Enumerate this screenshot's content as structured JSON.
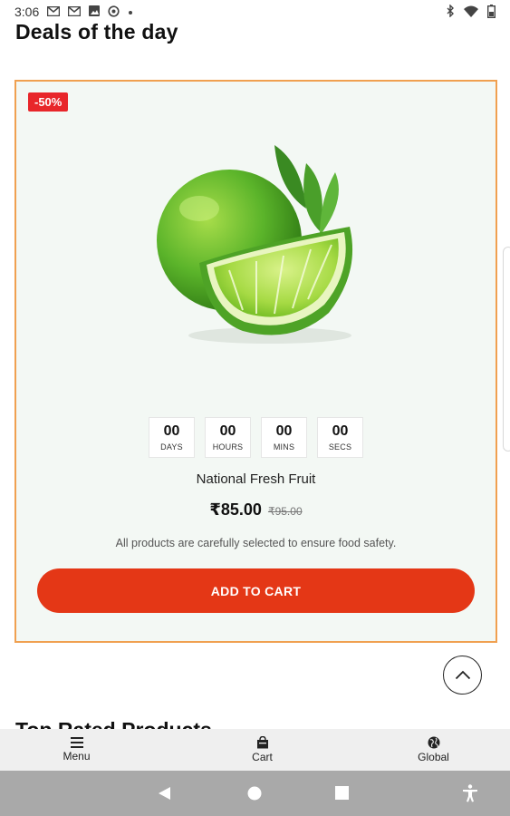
{
  "status_bar": {
    "time": "3:06",
    "left_icons": [
      "mail-icon",
      "mail-icon",
      "image-icon",
      "sync-icon",
      "dot-icon"
    ],
    "right_icons": [
      "bluetooth-icon",
      "wifi-icon",
      "battery-icon"
    ]
  },
  "section": {
    "title": "Deals of the day"
  },
  "deal": {
    "badge": "-50%",
    "image_icon": "lime-fruit-image",
    "countdown": [
      {
        "value": "00",
        "label": "DAYS"
      },
      {
        "value": "00",
        "label": "HOURS"
      },
      {
        "value": "00",
        "label": "MINS"
      },
      {
        "value": "00",
        "label": "SECS"
      }
    ],
    "product_name": "National Fresh Fruit",
    "price": "₹85.00",
    "old_price": "₹95.00",
    "description": "All products are carefully selected to ensure food safety.",
    "cta": "ADD TO CART"
  },
  "next_section": {
    "title": "Top Rated Products"
  },
  "bottom_nav": [
    {
      "label": "Menu",
      "icon": "hamburger-icon"
    },
    {
      "label": "Cart",
      "icon": "bag-icon"
    },
    {
      "label": "Global",
      "icon": "globe-icon"
    }
  ],
  "colors": {
    "accent": "#e43716",
    "badge": "#e8262a",
    "card_border": "#f0a050",
    "card_bg": "#f3f8f4"
  }
}
